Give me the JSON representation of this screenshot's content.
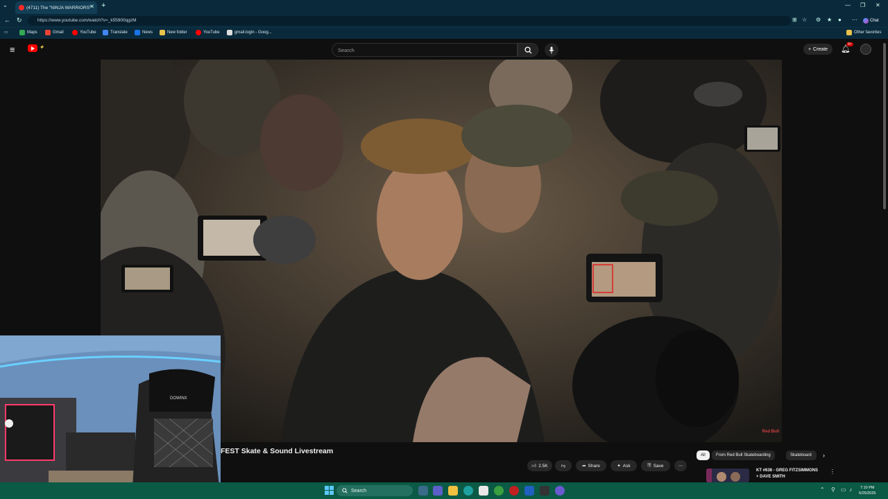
{
  "browser": {
    "tab_title": "(4711) The \"NINJA WARRIORS\"",
    "url": "https://www.youtube.com/watch?v=_k55900qgzM",
    "copilot_label": "Chat",
    "bookmarks": [
      {
        "label": "Maps",
        "color": "#34a853"
      },
      {
        "label": "Gmail",
        "color": "#ea4335"
      },
      {
        "label": "YouTube",
        "color": "#ff0000"
      },
      {
        "label": "Translate",
        "color": "#4285f4"
      },
      {
        "label": "News",
        "color": "#1a73e8"
      },
      {
        "label": "New folder",
        "color": "#e8c24a"
      },
      {
        "label": "YouTube",
        "color": "#ff0000"
      },
      {
        "label": "gmail.login - Goog...",
        "color": "#dddddd"
      }
    ],
    "other_favorites": "Other favorites"
  },
  "youtube": {
    "search_placeholder": "Search",
    "create_label": "Create",
    "notifications_badge": "9+",
    "video_title": "FEST Skate & Sound Livestream",
    "actions": {
      "likes": "2.5K",
      "share": "Share",
      "ask": "Ask",
      "save": "Save"
    },
    "chips": [
      "All",
      "From Red Bull Skateboarding",
      "Skateboard"
    ],
    "recommended": {
      "title_line1": "KT #638 - GREG FITZSIMMONS",
      "title_line2": "+ DAVE SMITH"
    },
    "watermark": "Red Bull"
  },
  "taskbar": {
    "search_label": "Search",
    "time": "7:10 PM",
    "date": "5/25/2025"
  },
  "colors": {
    "youtube_red": "#ff0000",
    "browser_chrome": "#0a2a3c",
    "taskbar": "#0b5a45"
  }
}
